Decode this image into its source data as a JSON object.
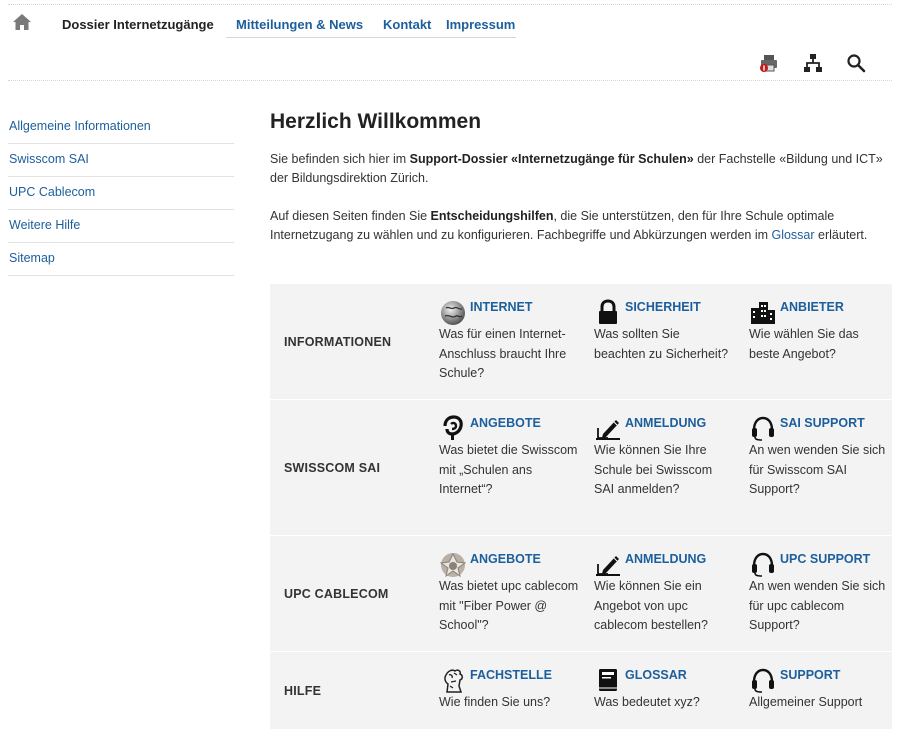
{
  "nav": {
    "items": [
      "Dossier Internetzugänge",
      "Mitteilungen & News",
      "Kontakt",
      "Impressum"
    ]
  },
  "tools": [
    "print-icon",
    "sitemap-icon",
    "search-icon"
  ],
  "sidebar": {
    "items": [
      "Allgemeine Informationen",
      "Swisscom SAI",
      "UPC Cablecom",
      "Weitere Hilfe",
      "Sitemap"
    ]
  },
  "main": {
    "title": "Herzlich Willkommen",
    "p1": {
      "t1": "Sie befinden sich hier im ",
      "b1": "Support-Dossier «Internetzugänge für Schulen»",
      "t2": " der Fachstelle «Bildung und ICT» der Bildungsdirektion Zürich."
    },
    "p2": {
      "t1": "Auf diesen Seiten finden Sie ",
      "b1": "Entscheidungshilfen",
      "t2": ", die Sie unterstützen, den für Ihre Schule optimale Internetzugang zu wählen und zu konfigurieren. Fachbegriffe und Abkürzungen werden im ",
      "link": "Glossar",
      "t3": " erläutert."
    }
  },
  "grid": [
    {
      "label": "INFORMATIONEN",
      "cells": [
        {
          "icon": "globe-icon",
          "title": "INTERNET",
          "desc": "Was für einen Internet-Anschluss braucht Ihre Schule?"
        },
        {
          "icon": "lock-icon",
          "title": "SICHERHEIT",
          "desc": "Was sollten Sie beachten zu Sicherheit?"
        },
        {
          "icon": "buildings-icon",
          "title": "ANBIETER",
          "desc": "Wie wählen Sie das beste Angebot?"
        }
      ]
    },
    {
      "label": "SWISSCOM SAI",
      "cells": [
        {
          "icon": "swisscom-logo-icon",
          "title": "ANGEBOTE",
          "desc": "Was bietet die Swisscom mit „Schulen ans Internet“?"
        },
        {
          "icon": "pen-signature-icon",
          "title": "ANMELDUNG",
          "desc": "Wie können Sie Ihre Schule bei Swisscom SAI anmelden?"
        },
        {
          "icon": "headset-icon",
          "title": "SAI SUPPORT",
          "desc": "An wen wenden Sie sich für Swisscom SAI Support?"
        }
      ]
    },
    {
      "label": "UPC CABLECOM",
      "cells": [
        {
          "icon": "upc-logo-icon",
          "title": "ANGEBOTE",
          "desc": "Was bietet upc cablecom mit \"Fiber Power @ School\"?"
        },
        {
          "icon": "pen-signature-icon",
          "title": "ANMELDUNG",
          "desc": "Wie können Sie ein Angebot von upc cablecom bestellen?"
        },
        {
          "icon": "headset-icon",
          "title": "UPC SUPPORT",
          "desc": "An wen wenden Sie sich für upc cablecom Support?"
        }
      ]
    },
    {
      "label": "HILFE",
      "cells": [
        {
          "icon": "zurich-lion-icon",
          "title": "FACHSTELLE",
          "desc": "Wie finden Sie uns?"
        },
        {
          "icon": "book-icon",
          "title": "GLOSSAR",
          "desc": "Was bedeutet xyz?"
        },
        {
          "icon": "headset-icon",
          "title": "SUPPORT",
          "desc": "Allgemeiner Support"
        }
      ]
    }
  ],
  "colors": {
    "link": "#1c5f9c",
    "grid_bg": "#f3f3f3",
    "text": "#333333"
  }
}
